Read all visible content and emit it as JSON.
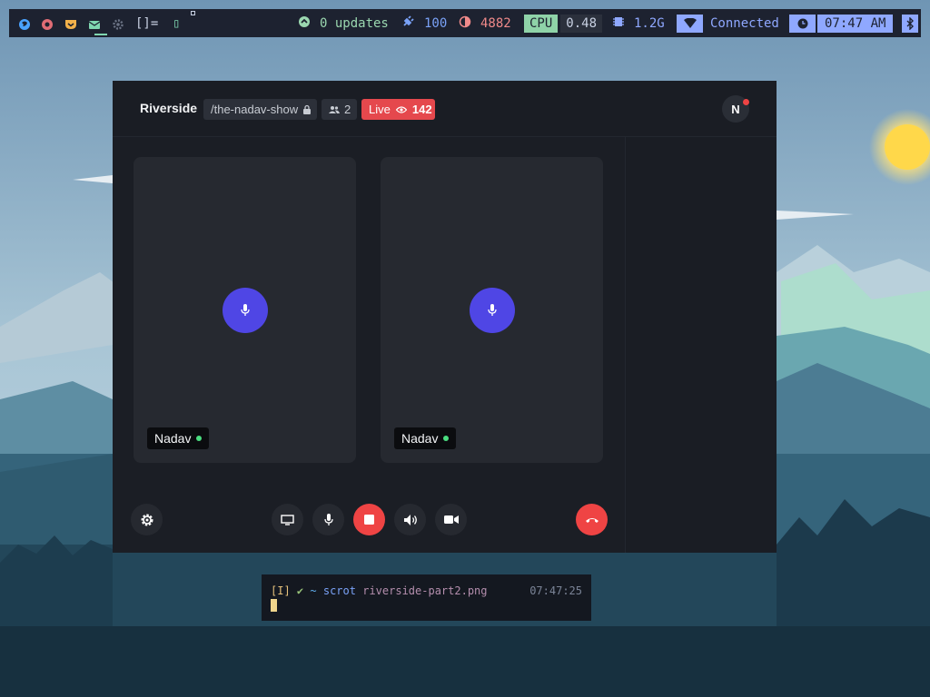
{
  "topbar": {
    "launchers": [
      {
        "icon": "firefox-icon",
        "color": "#4aa3ff"
      },
      {
        "icon": "chrome-icon",
        "color": "#e06c75"
      },
      {
        "icon": "pocket-icon",
        "color": "#f3b14a"
      },
      {
        "icon": "mail-icon",
        "color": "#7fd6b0"
      },
      {
        "icon": "settings-cog-icon",
        "color": "#6b7385"
      }
    ],
    "layout_symbol": "[]=",
    "layout_extra": "▯",
    "updates": {
      "icon": "arrow-up-circle-icon",
      "label": "0 updates",
      "color": "#9bd8b0"
    },
    "battery": {
      "icon": "plug-icon",
      "value": "100",
      "color": "#7aa2f7"
    },
    "brightness": {
      "icon": "contrast-icon",
      "value": "4882",
      "color": "#f08a8a"
    },
    "cpu": {
      "label": "CPU",
      "value": "0.48",
      "label_bg": "#8fd3a8"
    },
    "memory": {
      "icon": "chip-icon",
      "value": "1.2G",
      "color": "#8fa8ff"
    },
    "network": {
      "icon": "wifi-icon",
      "label": "Connected",
      "color": "#8fa8ff"
    },
    "clock": {
      "icon": "clock-icon",
      "time": "07:47 AM",
      "bg": "#8fa8ff"
    },
    "tray": {
      "icon": "bluetooth-icon"
    }
  },
  "app": {
    "brand": "Riverside",
    "path": "/the-nadav-show",
    "participants": "2",
    "live_label": "Live",
    "viewers": "142",
    "avatar_initial": "N",
    "tiles": [
      {
        "name": "Nadav",
        "status": "online"
      },
      {
        "name": "Nadav",
        "status": "online"
      }
    ],
    "controls": [
      "settings",
      "screen-share",
      "microphone",
      "stop-recording",
      "speaker",
      "camera",
      "end-call"
    ]
  },
  "terminal": {
    "mode": "[I]",
    "check": "✔",
    "cwd": "~",
    "command": "scrot",
    "argument": "riverside-part2.png",
    "time": "07:47:25"
  }
}
